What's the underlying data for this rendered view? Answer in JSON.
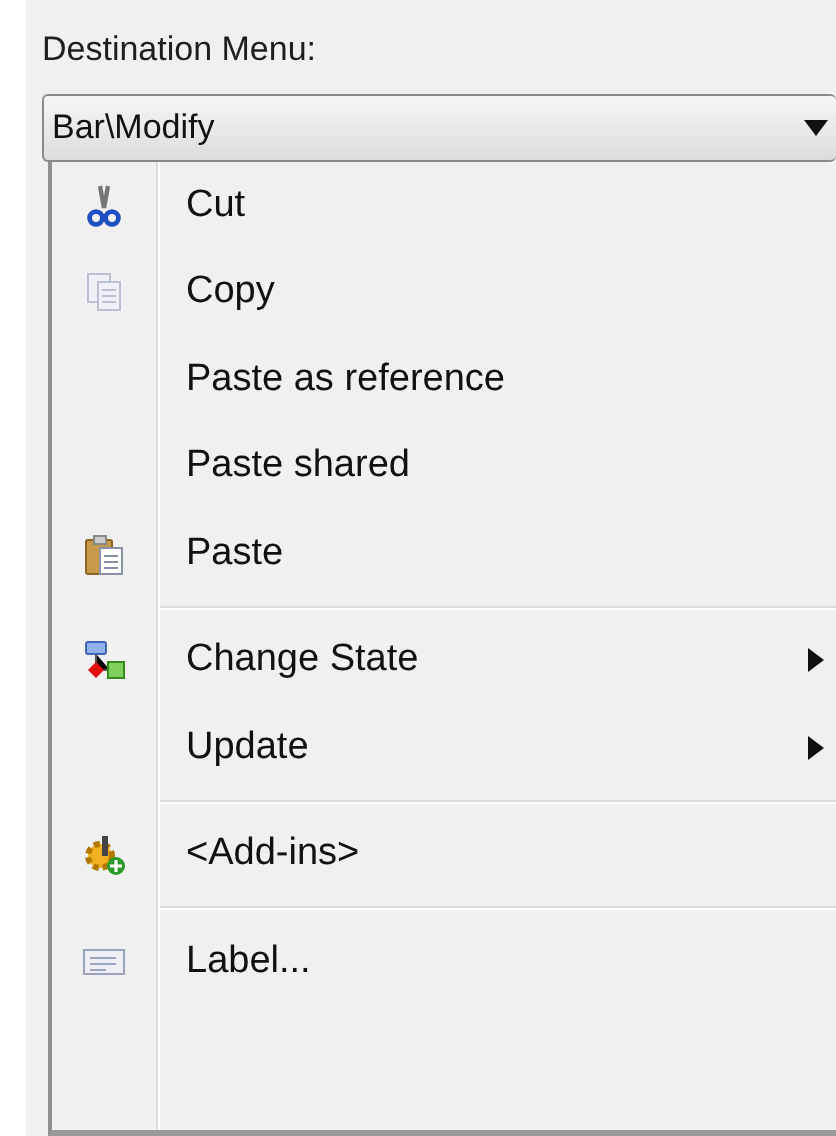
{
  "label": "Destination Menu:",
  "dropdown": {
    "value": "Bar\\Modify"
  },
  "menu": [
    {
      "kind": "item",
      "label": "Cut",
      "submenu": false
    },
    {
      "kind": "item",
      "label": "Copy",
      "submenu": false
    },
    {
      "kind": "item",
      "label": "Paste as reference",
      "submenu": false
    },
    {
      "kind": "item",
      "label": "Paste shared",
      "submenu": false
    },
    {
      "kind": "item",
      "label": "Paste",
      "submenu": false
    },
    {
      "kind": "separator"
    },
    {
      "kind": "item",
      "label": "Change State",
      "submenu": true
    },
    {
      "kind": "item",
      "label": "Update",
      "submenu": true
    },
    {
      "kind": "separator"
    },
    {
      "kind": "item",
      "label": "<Add-ins>",
      "submenu": false
    },
    {
      "kind": "separator"
    },
    {
      "kind": "item",
      "label": "Label...",
      "submenu": false
    }
  ]
}
